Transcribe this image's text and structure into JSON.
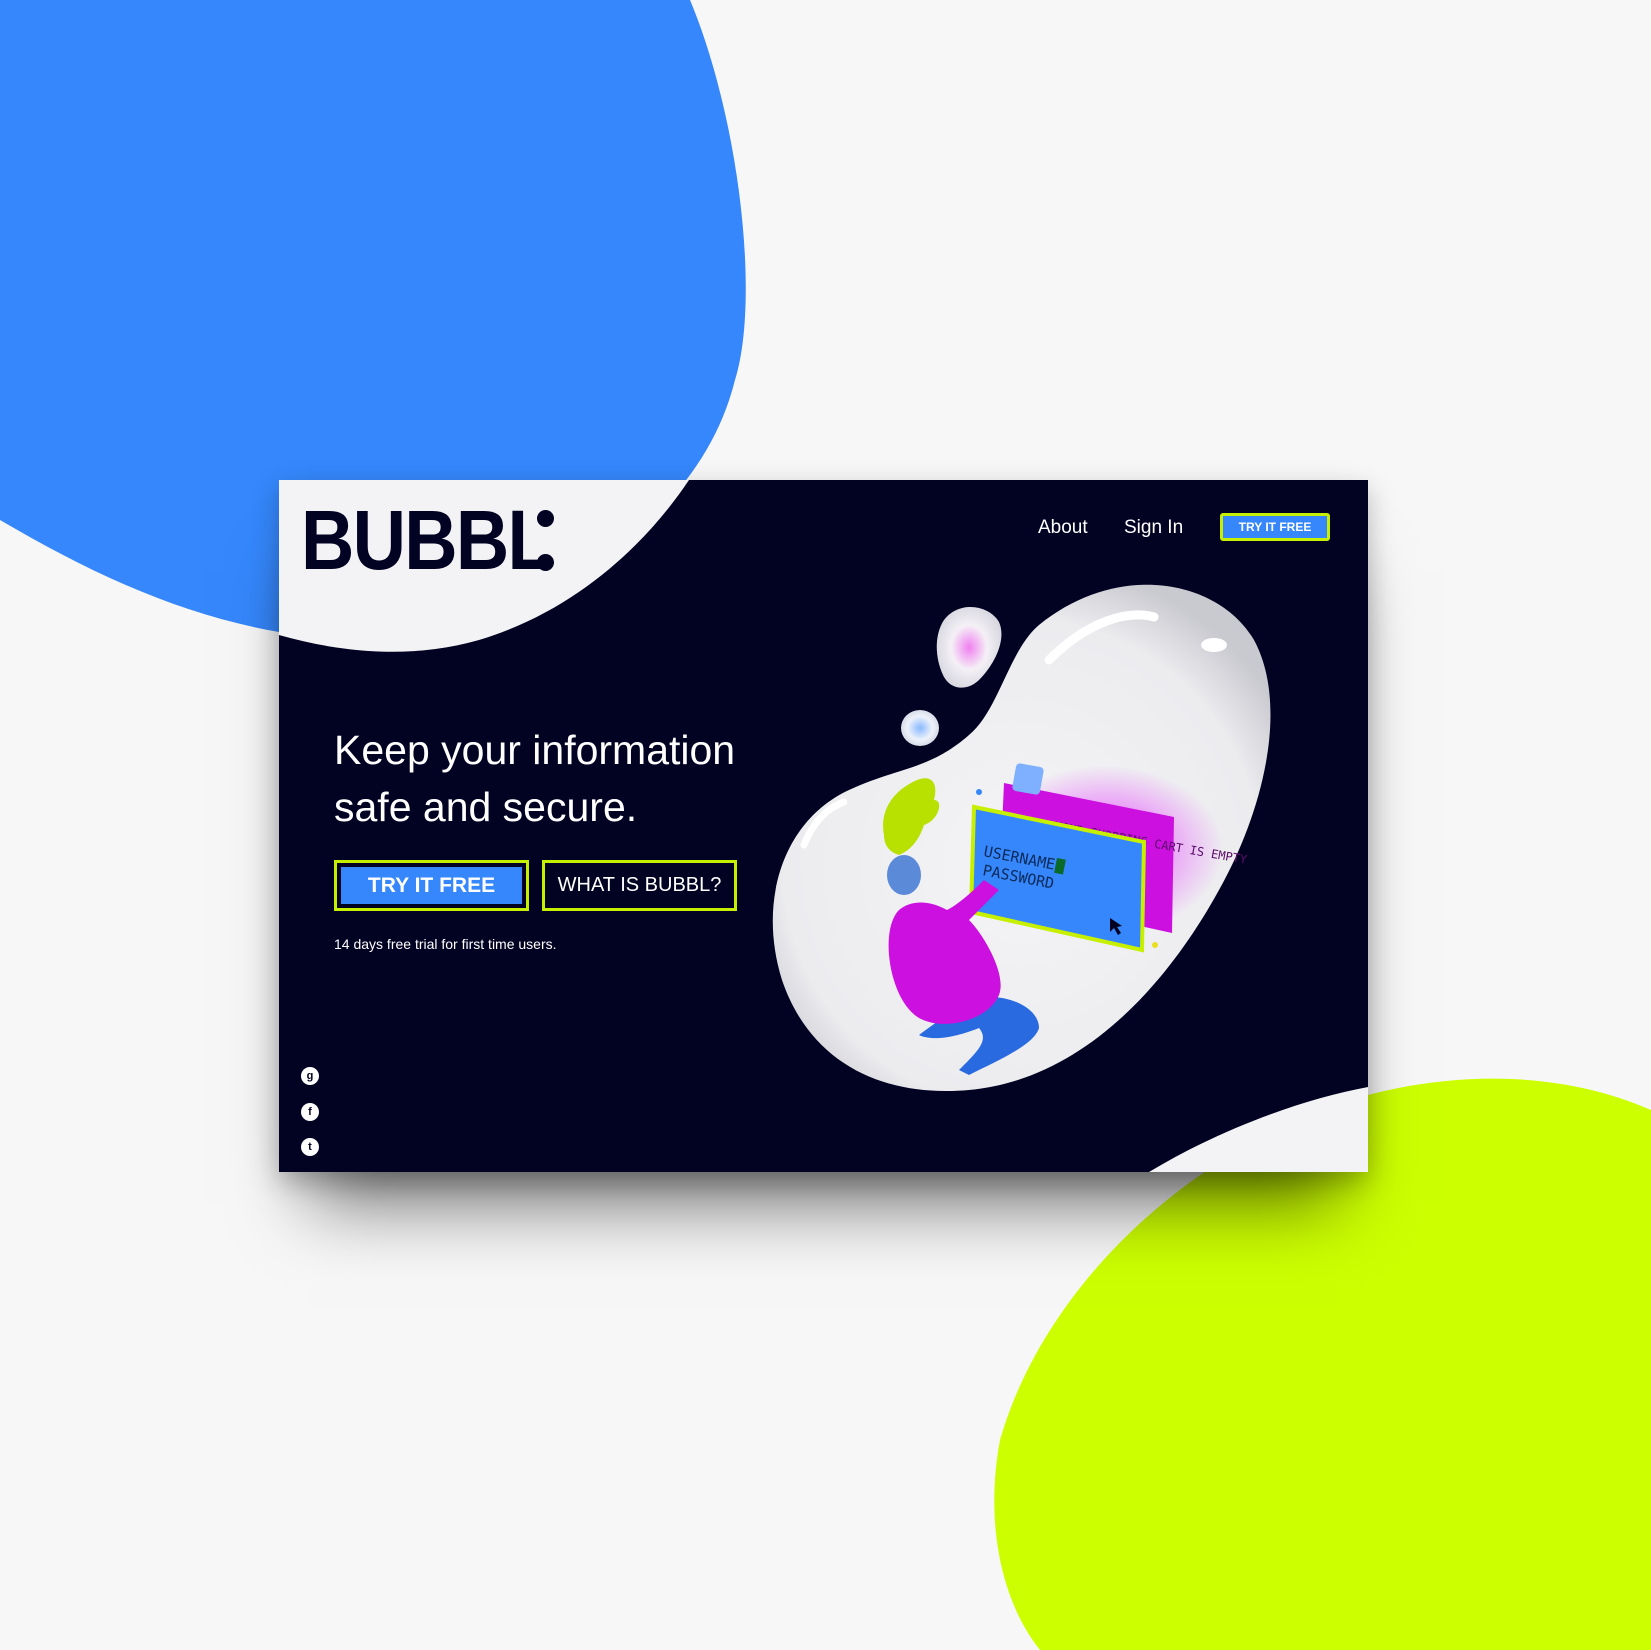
{
  "brand": {
    "name": "BUBBL"
  },
  "nav": {
    "links": [
      "About",
      "Sign In"
    ],
    "cta": "TRY IT FREE"
  },
  "hero": {
    "headline_line1": "Keep your information",
    "headline_line2": "safe and secure.",
    "primary_button": "TRY IT FREE",
    "secondary_button": "WHAT IS BUBBL?",
    "note": "14 days free trial for first time users."
  },
  "illustration": {
    "login_line1": "USERNAME",
    "login_line2": "PASSWORD",
    "cart_message": "YOUR SHOPPING CART IS EMPTY"
  },
  "social": [
    "google-plus-icon",
    "facebook-icon",
    "twitter-icon"
  ],
  "colors": {
    "navy": "#020222",
    "blue": "#3587fb",
    "lime": "#c6f000",
    "magenta": "#cc10e0",
    "background": "#f7f7f7"
  }
}
